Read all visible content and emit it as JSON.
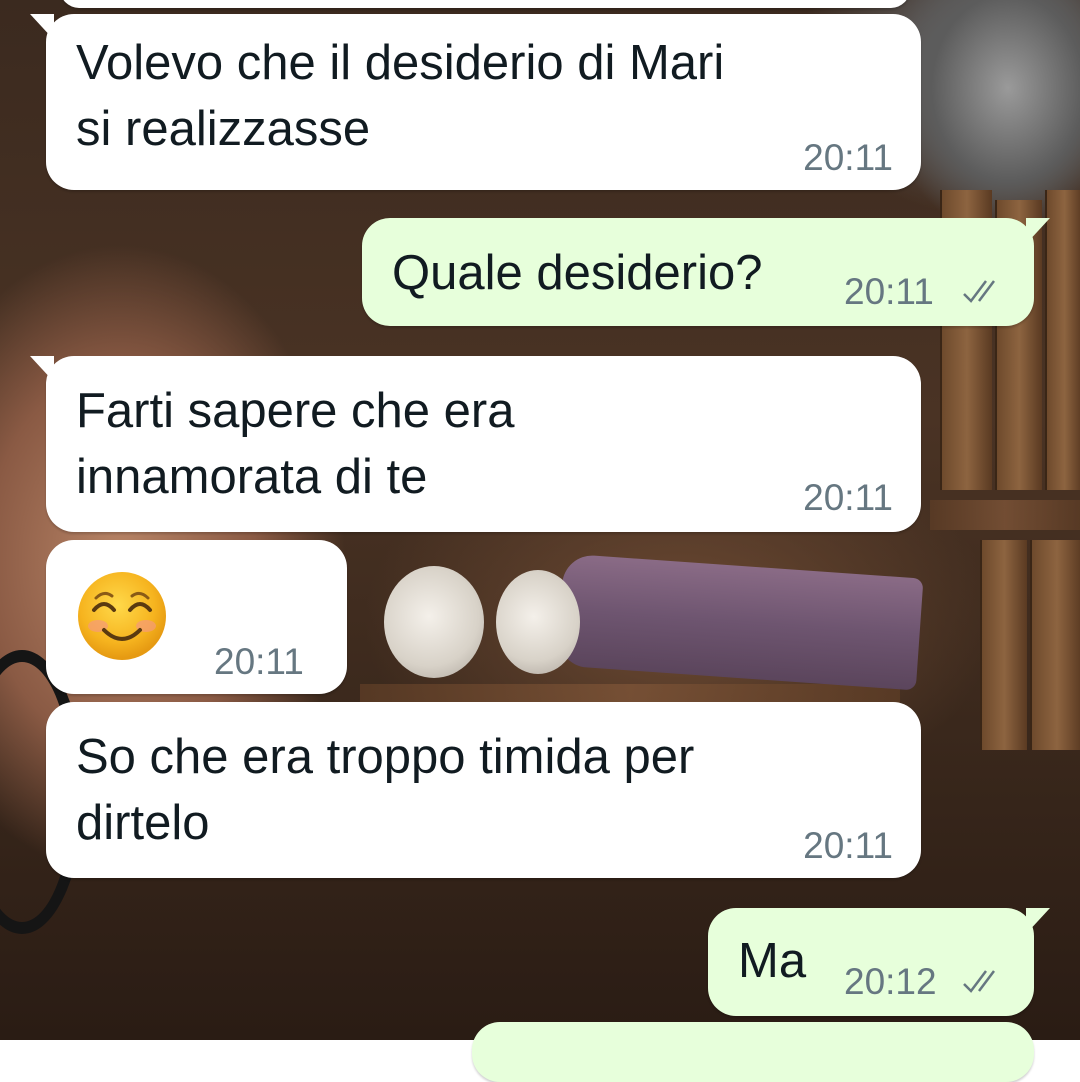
{
  "chat": {
    "background_colors": {
      "incoming_bubble": "#ffffff",
      "outgoing_bubble": "#e7ffdb",
      "text": "#111b21",
      "meta": "#667781"
    },
    "messages": [
      {
        "direction": "incoming",
        "text": "Volevo che il desiderio di Mari\nsi realizzasse",
        "time": "20:11"
      },
      {
        "direction": "outgoing",
        "text": "Quale desiderio?",
        "time": "20:11",
        "status": "read-double-check-icon"
      },
      {
        "direction": "incoming",
        "text": "Farti sapere che era\ninnamorata di te",
        "time": "20:11"
      },
      {
        "direction": "incoming",
        "text": "",
        "emoji": "smiling-face-with-smiling-eyes-emoji",
        "time": "20:11"
      },
      {
        "direction": "incoming",
        "text": "So che era troppo timida per\ndirtelo",
        "time": "20:11"
      },
      {
        "direction": "outgoing",
        "text": "Ma",
        "time": "20:12",
        "status": "read-double-check-icon"
      },
      {
        "direction": "outgoing",
        "text": "",
        "time": "",
        "partial": true
      }
    ]
  }
}
